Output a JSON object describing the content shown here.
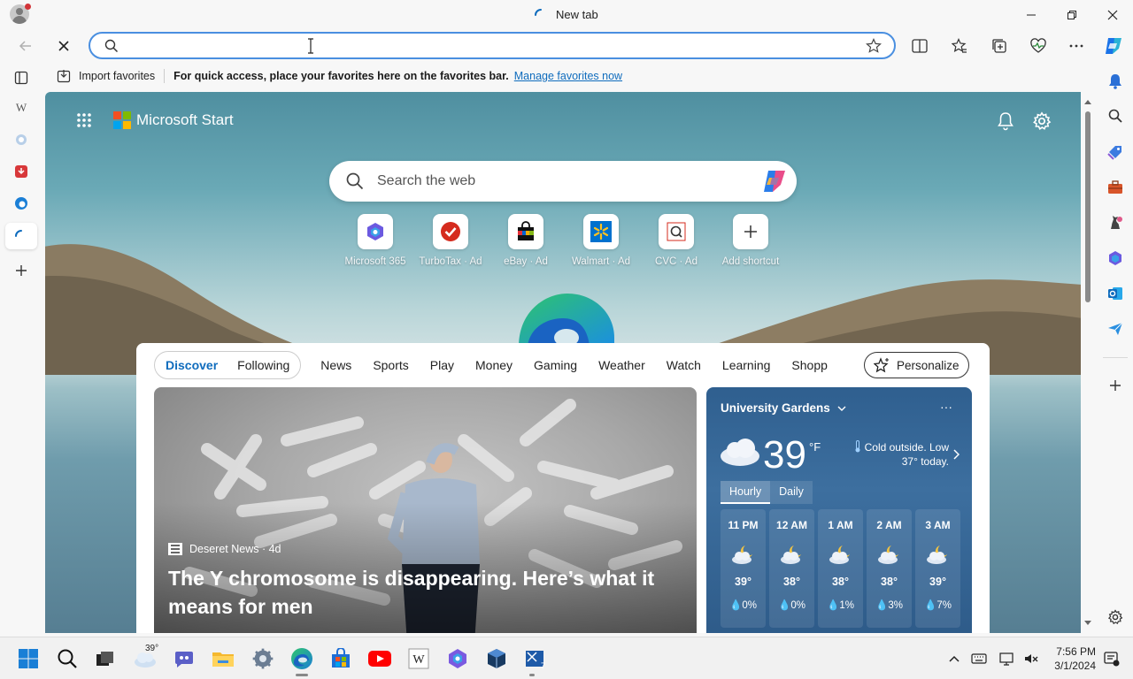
{
  "window": {
    "tab_title": "New tab"
  },
  "address": {
    "value": "",
    "placeholder": ""
  },
  "favorites_bar": {
    "import_label": "Import favorites",
    "message": "For quick access, place your favorites here on the favorites bar.",
    "link": "Manage favorites now"
  },
  "left_sidebar": {
    "items": [
      "tab-actions-icon",
      "wikipedia-icon",
      "extension-icon",
      "download-app-icon",
      "edge-app-icon",
      "loading-tab-icon",
      "add-icon"
    ]
  },
  "right_sidebar": {
    "items": [
      "bell-icon",
      "search-icon",
      "tag-icon",
      "toolbox-icon",
      "games-icon",
      "microsoft365-icon",
      "outlook-icon",
      "send-icon",
      "add-icon",
      "settings-icon"
    ]
  },
  "start": {
    "brand": "Microsoft Start",
    "search_placeholder": "Search the web",
    "shortcuts": [
      {
        "label": "Microsoft 365"
      },
      {
        "label": "TurboTax · Ad"
      },
      {
        "label": "eBay · Ad"
      },
      {
        "label": "Walmart · Ad"
      },
      {
        "label": "CVC · Ad"
      },
      {
        "label": "Add shortcut"
      }
    ]
  },
  "feed": {
    "tabs": [
      "Discover",
      "Following"
    ],
    "active_tab": "Discover",
    "categories": [
      "News",
      "Sports",
      "Play",
      "Money",
      "Gaming",
      "Weather",
      "Watch",
      "Learning",
      "Shopp"
    ],
    "personalize_label": "Personalize",
    "hero": {
      "source": "Deseret News · 4d",
      "headline": "The Y chromosome is disappearing. Here’s what it means for men"
    }
  },
  "weather": {
    "location": "University Gardens",
    "more": "···",
    "temperature": "39",
    "unit": "°F",
    "message": "Cold outside. Low 37° today.",
    "tabs": [
      "Hourly",
      "Daily"
    ],
    "active_tab": "Hourly",
    "hours": [
      {
        "time": "11 PM",
        "temp": "39°",
        "precip": "0%"
      },
      {
        "time": "12 AM",
        "temp": "38°",
        "precip": "0%"
      },
      {
        "time": "1 AM",
        "temp": "38°",
        "precip": "1%"
      },
      {
        "time": "2 AM",
        "temp": "38°",
        "precip": "3%"
      },
      {
        "time": "3 AM",
        "temp": "39°",
        "precip": "7%"
      }
    ]
  },
  "taskbar": {
    "weather_badge": "39°",
    "time": "7:56 PM",
    "date": "3/1/2024"
  },
  "colors": {
    "accent": "#0f6cbd",
    "address_border": "#4a8fe0"
  }
}
